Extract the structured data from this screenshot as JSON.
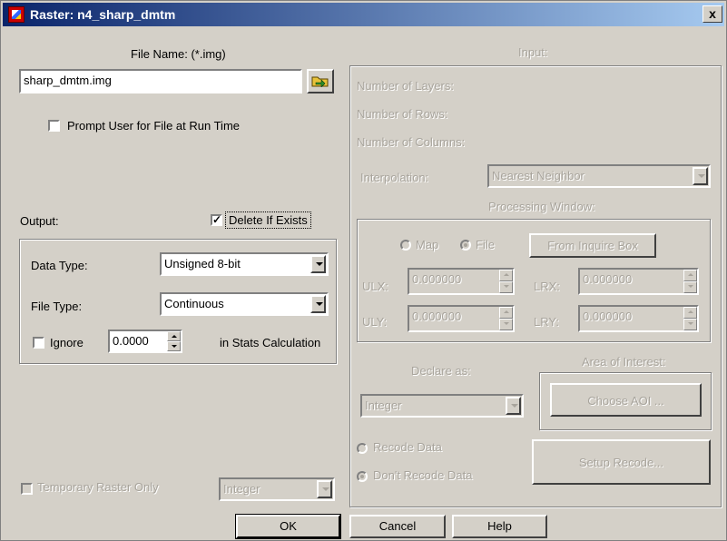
{
  "window": {
    "title": "Raster: n4_sharp_dmtm",
    "close": "x"
  },
  "left": {
    "file_name_label": "File Name: (*.img)",
    "file_name_value": "sharp_dmtm.img",
    "prompt_label": "Prompt User for File at Run Time",
    "prompt_checked": false,
    "output_label": "Output:",
    "delete_if_exists_label": "Delete If Exists",
    "delete_if_exists_checked": true,
    "data_type_label": "Data Type:",
    "data_type_value": "Unsigned 8-bit",
    "file_type_label": "File Type:",
    "file_type_value": "Continuous",
    "ignore_label": "Ignore",
    "ignore_value": "0.0000",
    "stats_label": "in Stats Calculation",
    "temp_raster_label": "Temporary Raster Only",
    "temp_raster_type": "Integer"
  },
  "right": {
    "input_label": "Input:",
    "layers_label": "Number of Layers:",
    "rows_label": "Number of Rows:",
    "columns_label": "Number of Columns:",
    "interpolation_label": "Interpolation:",
    "interpolation_value": "Nearest Neighbor",
    "processing_window_label": "Processing Window:",
    "map_label": "Map",
    "file_label": "File",
    "inquire_button": "From Inquire Box",
    "ulx_label": "ULX:",
    "ulx_value": "0.000000",
    "lrx_label": "LRX:",
    "lrx_value": "0.000000",
    "uly_label": "ULY:",
    "uly_value": "0.000000",
    "lry_label": "LRY:",
    "lry_value": "0.000000",
    "declare_label": "Declare as:",
    "declare_value": "Integer",
    "aoi_label": "Area of Interest:",
    "choose_aoi_button": "Choose AOI ...",
    "recode_label": "Recode Data",
    "dont_recode_label": "Don't Recode Data",
    "setup_recode_button": "Setup Recode..."
  },
  "buttons": {
    "ok": "OK",
    "cancel": "Cancel",
    "help": "Help"
  }
}
